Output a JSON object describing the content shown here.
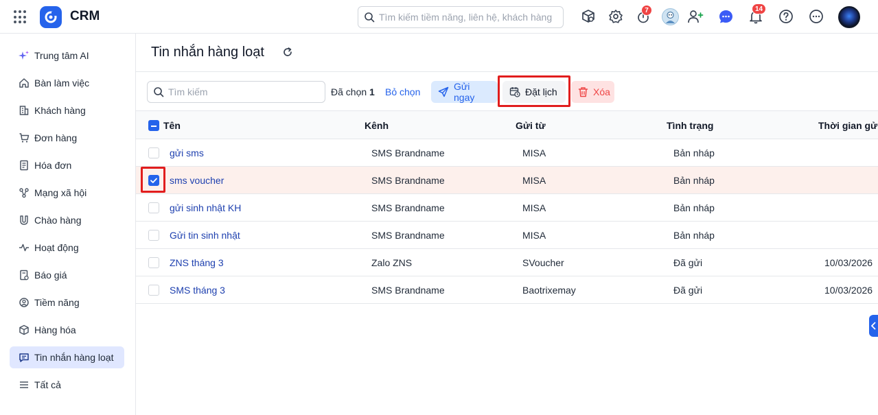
{
  "app": {
    "title": "CRM"
  },
  "topbar": {
    "search_placeholder": "Tìm kiếm tiềm năng, liên hệ, khách hàng",
    "timer_badge": "7",
    "notification_badge": "14"
  },
  "sidebar": {
    "items": [
      {
        "label": "Trung tâm AI",
        "icon": "sparkle-icon"
      },
      {
        "label": "Bàn làm việc",
        "icon": "home-icon"
      },
      {
        "label": "Khách hàng",
        "icon": "building-icon"
      },
      {
        "label": "Đơn hàng",
        "icon": "cart-icon"
      },
      {
        "label": "Hóa đơn",
        "icon": "invoice-icon"
      },
      {
        "label": "Mạng xã hội",
        "icon": "share-icon"
      },
      {
        "label": "Chào hàng",
        "icon": "magnet-icon"
      },
      {
        "label": "Hoạt động",
        "icon": "activity-icon"
      },
      {
        "label": "Báo giá",
        "icon": "quote-icon"
      },
      {
        "label": "Tiềm năng",
        "icon": "target-icon"
      },
      {
        "label": "Hàng hóa",
        "icon": "box-icon"
      },
      {
        "label": "Tin nhắn hàng loạt",
        "icon": "message-icon",
        "active": true
      },
      {
        "label": "Tất cả",
        "icon": "menu-icon"
      }
    ]
  },
  "page": {
    "title": "Tin nhắn hàng loạt"
  },
  "toolbar": {
    "search_placeholder": "Tìm kiếm",
    "selected_label": "Đã chọn",
    "selected_count": "1",
    "deselect_label": "Bỏ chọn",
    "send_now_label": "Gửi ngay",
    "schedule_label": "Đặt lịch",
    "delete_label": "Xóa"
  },
  "table": {
    "columns": [
      "Tên",
      "Kênh",
      "Gửi từ",
      "Tình trạng",
      "Thời gian gửi"
    ],
    "rows": [
      {
        "name": "gửi sms",
        "channel": "SMS Brandname",
        "from": "MISA",
        "status": "Bản nháp",
        "sent_time": "",
        "checked": false
      },
      {
        "name": "sms voucher",
        "channel": "SMS Brandname",
        "from": "MISA",
        "status": "Bản nháp",
        "sent_time": "",
        "checked": true
      },
      {
        "name": "gửi sinh nhật KH",
        "channel": "SMS Brandname",
        "from": "MISA",
        "status": "Bản nháp",
        "sent_time": "",
        "checked": false
      },
      {
        "name": "Gửi tin sinh nhật",
        "channel": "SMS Brandname",
        "from": "MISA",
        "status": "Bản nháp",
        "sent_time": "",
        "checked": false
      },
      {
        "name": "ZNS tháng 3",
        "channel": "Zalo ZNS",
        "from": "SVoucher",
        "status": "Đã gửi",
        "sent_time": "10/03/2026",
        "checked": false
      },
      {
        "name": "SMS tháng 3",
        "channel": "SMS Brandname",
        "from": "Baotrixemay",
        "status": "Đã gửi",
        "sent_time": "10/03/2026",
        "checked": false
      }
    ]
  },
  "colors": {
    "accent": "#2563eb",
    "danger": "#ef4444",
    "highlight": "#e11d1d",
    "selected_row": "#fdf0ec"
  }
}
